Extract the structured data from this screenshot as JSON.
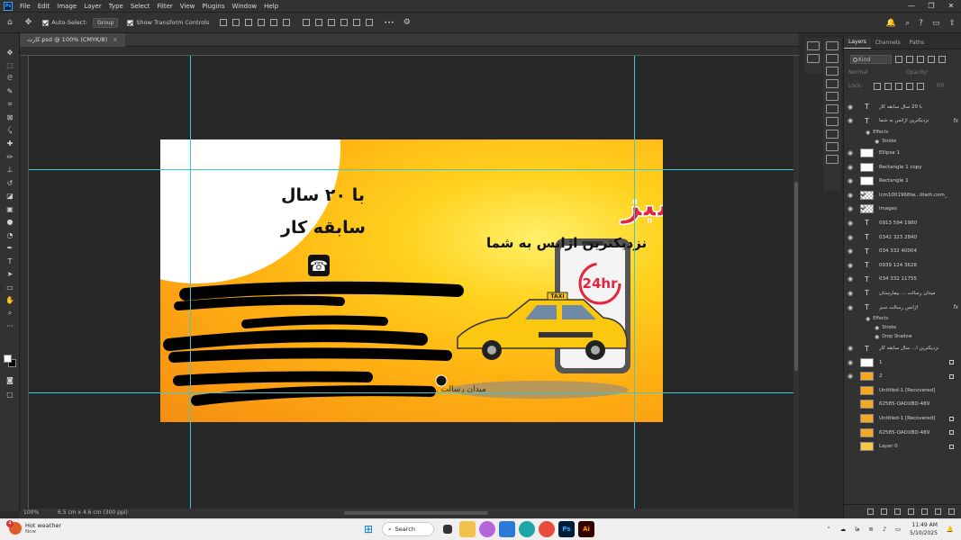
{
  "app": {
    "logo": "Ps"
  },
  "menu": [
    "File",
    "Edit",
    "Image",
    "Layer",
    "Type",
    "Select",
    "Filter",
    "View",
    "Plugins",
    "Window",
    "Help"
  ],
  "window_controls": [
    "—",
    "❐",
    "✕"
  ],
  "options": {
    "auto_select_label": "Auto-Select:",
    "auto_select_value": "Group",
    "transform_label": "Show Transform Controls",
    "more": "•••"
  },
  "document": {
    "tab_title": "کارت.psd @ 100% (CMYK/8)",
    "close": "×"
  },
  "status": {
    "zoom": "100%",
    "dimensions": "6.5 cm x 4.6 cm (300 ppi)"
  },
  "artwork": {
    "title": "آژانس رسالت سبز",
    "subtitle": "نزدیکترین اژانس به شما",
    "badge_line1": "با ۲۰ سال",
    "badge_line2": "سابقه کار",
    "phone_icon": "☎",
    "timer_text": "24hr",
    "taxi_text": "TAXI",
    "address": "میدان رسالت ..."
  },
  "layers_panel": {
    "tabs": [
      "Layers",
      "Channels",
      "Paths"
    ],
    "filter_kind": "Kind",
    "blend_mode": "Normal",
    "opacity_label": "Opacity:",
    "lock_label": "Lock:",
    "fill_label": "Fill:",
    "layers": [
      {
        "type": "text",
        "name": "با 20 سال سابقه کار",
        "fx": false,
        "lock": false
      },
      {
        "type": "text",
        "name": "نزدیکترین اژانس به شما",
        "fx": true,
        "lock": false
      },
      {
        "type": "sub",
        "name": "Effects"
      },
      {
        "type": "sub2",
        "name": "Stroke"
      },
      {
        "type": "img",
        "name": "Ellipse 1",
        "fx": false,
        "lock": false
      },
      {
        "type": "img",
        "name": "Rectangle 1 copy",
        "fx": false,
        "lock": false
      },
      {
        "type": "img",
        "name": "Rectangle 1",
        "fx": false,
        "lock": false
      },
      {
        "type": "chk",
        "name": "lcm1001968lw...iltarh.com_",
        "fx": false,
        "lock": false
      },
      {
        "type": "chk",
        "name": "images",
        "fx": false,
        "lock": false
      },
      {
        "type": "text",
        "name": "0913 594 1980",
        "fx": false,
        "lock": false
      },
      {
        "type": "text",
        "name": "0342 323 2840",
        "fx": false,
        "lock": false
      },
      {
        "type": "text",
        "name": "034 332 40004",
        "fx": false,
        "lock": false
      },
      {
        "type": "text",
        "name": "0939 124 3628",
        "fx": false,
        "lock": false
      },
      {
        "type": "text",
        "name": "034 332 11755",
        "fx": false,
        "lock": false
      },
      {
        "type": "text",
        "name": "میدان رسالت ... بیمارستان",
        "fx": false,
        "lock": false
      },
      {
        "type": "text",
        "name": "آژانس رسالت سبز",
        "fx": true,
        "lock": false
      },
      {
        "type": "sub",
        "name": "Effects"
      },
      {
        "type": "sub2",
        "name": "Stroke"
      },
      {
        "type": "sub2",
        "name": "Drop Shadow"
      },
      {
        "type": "text",
        "name": "نزدیکترین ا... سال سابقه کار",
        "fx": false,
        "lock": false
      },
      {
        "type": "img",
        "name": "1",
        "fx": false,
        "lock": true
      },
      {
        "type": "ylw",
        "name": "2",
        "fx": false,
        "lock": true
      },
      {
        "type": "ylw",
        "name": "Untitled-1 [Recovered]",
        "fx": false,
        "lock": false
      },
      {
        "type": "ylw",
        "name": "62585-OADXBD-489",
        "fx": false,
        "lock": false
      },
      {
        "type": "ylw",
        "name": "Untitled-1 [Recovered]",
        "fx": false,
        "lock": true
      },
      {
        "type": "ylw",
        "name": "62585-OADXBD-489",
        "fx": false,
        "lock": true
      },
      {
        "type": "ylw2",
        "name": "Layer 0",
        "fx": false,
        "lock": true
      }
    ]
  },
  "taskbar": {
    "weather_title": "Hot weather",
    "weather_sub": "Now",
    "weather_badge": "4",
    "search": "Search",
    "time": "11:49 AM",
    "date": "5/10/2025",
    "lang": "فا"
  },
  "colors": {
    "accent_guides": "#3ec5d6",
    "card_orange": "#f58d12",
    "card_yellow": "#ffd21e",
    "title_red": "#e8243c"
  }
}
